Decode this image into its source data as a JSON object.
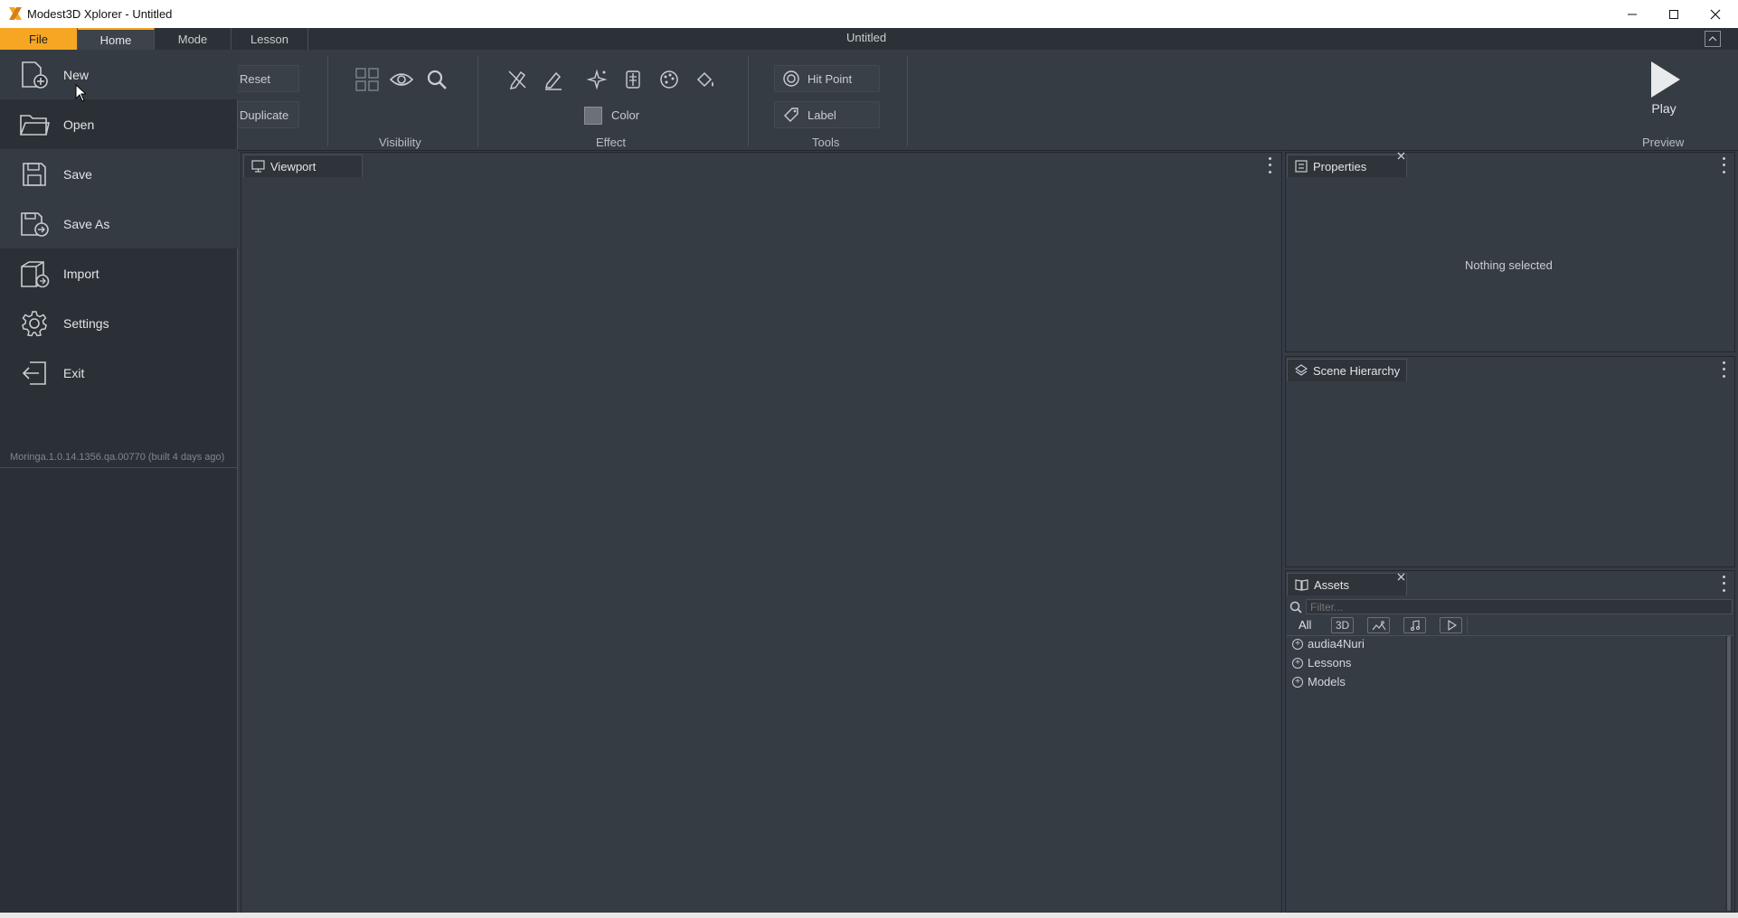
{
  "window": {
    "title": "Modest3D Xplorer - Untitled",
    "minimize_icon": "minimize-icon",
    "maximize_icon": "maximize-icon",
    "close_icon": "close-icon"
  },
  "tabs": [
    {
      "label": "File"
    },
    {
      "label": "Home"
    },
    {
      "label": "Mode"
    },
    {
      "label": "Lesson"
    }
  ],
  "document_title": "Untitled",
  "ribbon": {
    "reset_label": "Reset",
    "duplicate_label": "Duplicate",
    "visibility_label": "Visibility",
    "effect_label": "Effect",
    "color_label": "Color",
    "tools_label": "Tools",
    "hit_point_label": "Hit Point",
    "label_label": "Label",
    "preview_label": "Preview",
    "play_label": "Play"
  },
  "file_menu": {
    "items": [
      {
        "label": "New",
        "icon": "new-file-icon"
      },
      {
        "label": "Open",
        "icon": "folder-open-icon"
      },
      {
        "label": "Save",
        "icon": "save-icon"
      },
      {
        "label": "Save As",
        "icon": "save-as-icon"
      },
      {
        "label": "Import",
        "icon": "import-icon"
      },
      {
        "label": "Settings",
        "icon": "gear-icon"
      },
      {
        "label": "Exit",
        "icon": "exit-icon"
      }
    ],
    "version": "Moringa.1.0.14.1356.qa.00770 (built 4 days ago)"
  },
  "panels": {
    "viewport": {
      "title": "Viewport"
    },
    "properties": {
      "title": "Properties",
      "empty_text": "Nothing selected"
    },
    "scene_hierarchy": {
      "title": "Scene Hierarchy"
    },
    "assets": {
      "title": "Assets",
      "filter_placeholder": "Filter...",
      "filter_all": "All",
      "filter_3d": "3D",
      "items": [
        {
          "label": "audia4Nuri"
        },
        {
          "label": "Lessons"
        },
        {
          "label": "Models"
        }
      ]
    }
  },
  "colors": {
    "accent": "#f6a623",
    "background": "#363c44",
    "menu_background": "#2b3036"
  }
}
